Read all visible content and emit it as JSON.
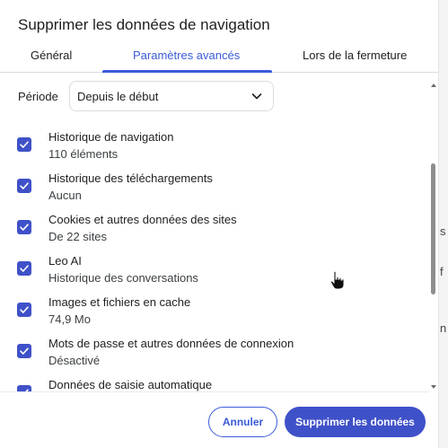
{
  "dialog": {
    "title": "Supprimer les données de navigation"
  },
  "tabs": [
    {
      "label": "Général",
      "active": false
    },
    {
      "label": "Paramètres avancés",
      "active": true
    },
    {
      "label": "Lors de la fermeture",
      "active": false
    }
  ],
  "period": {
    "label": "Période",
    "value": "Depuis le début"
  },
  "items": [
    {
      "title": "Historique de navigation",
      "subtitle": "110 éléments",
      "checked": true
    },
    {
      "title": "Historique des téléchargements",
      "subtitle": "Aucun",
      "checked": true
    },
    {
      "title": "Cookies et autres données des sites",
      "subtitle": "De 22 sites",
      "checked": true
    },
    {
      "title": "Leo AI",
      "subtitle": "Historique des conversations",
      "checked": true
    },
    {
      "title": "Images et fichiers en cache",
      "subtitle": "74,9 Mo",
      "checked": true
    },
    {
      "title": "Mots de passe et autres données de connexion",
      "subtitle": "Désactivé",
      "checked": true
    },
    {
      "title": "Données de saisie automatique",
      "subtitle": "",
      "checked": true
    }
  ],
  "buttons": {
    "cancel": "Annuler",
    "confirm": "Supprimer les données"
  },
  "background_fragments": [
    "s",
    "f",
    "n"
  ],
  "colors": {
    "accent": "#3b5bd9",
    "checkbox": "#3f51c8"
  }
}
